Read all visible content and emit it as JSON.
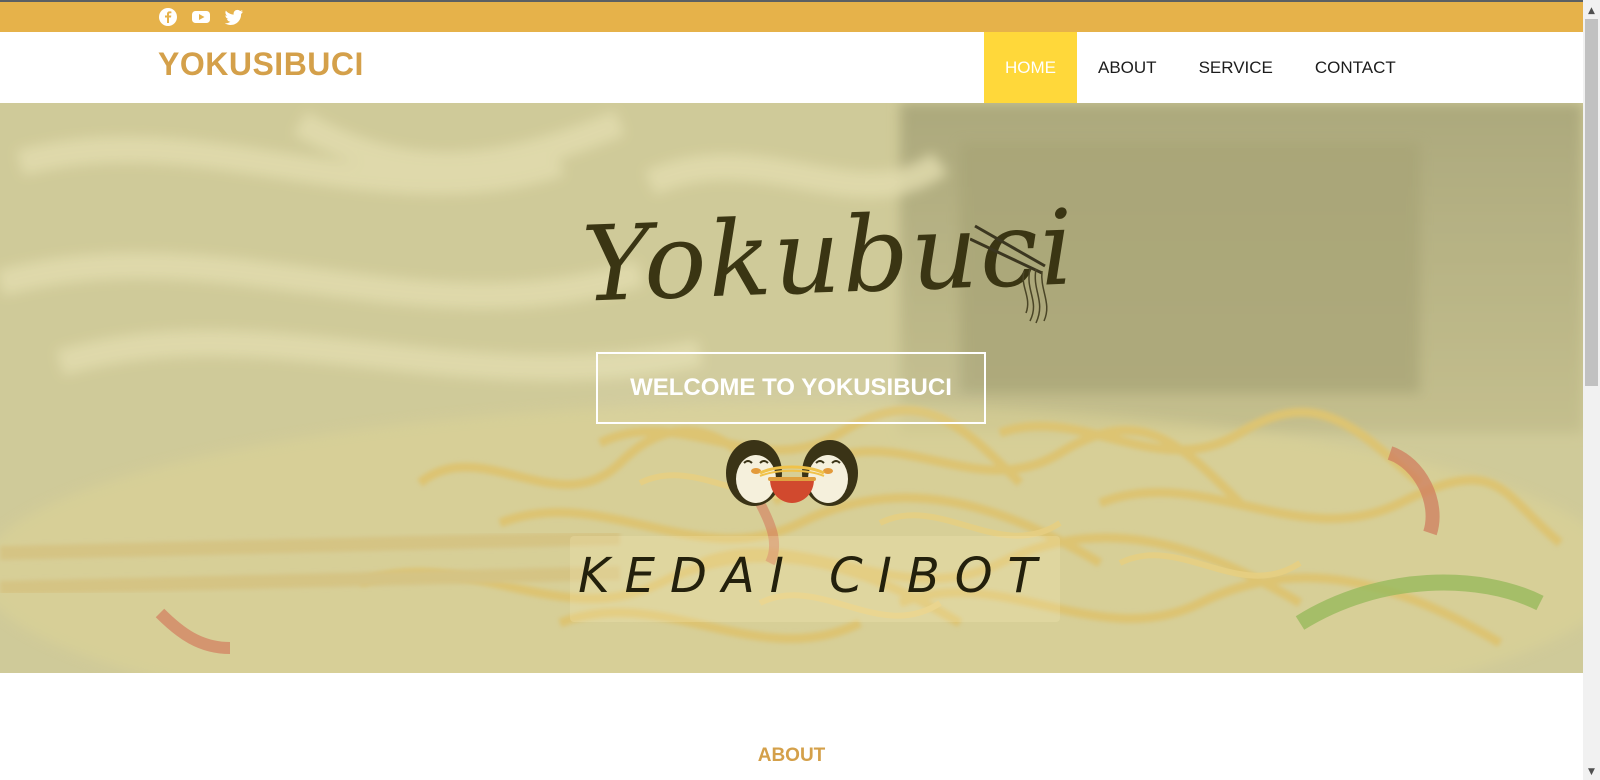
{
  "topbar": {
    "social": [
      {
        "icon": "facebook-icon"
      },
      {
        "icon": "youtube-icon"
      },
      {
        "icon": "twitter-icon"
      }
    ],
    "color": "#e6b24a"
  },
  "header": {
    "brand": "YOKUSIBUCI",
    "brand_color": "#d4a04a",
    "nav": [
      {
        "label": "HOME",
        "active": true
      },
      {
        "label": "ABOUT",
        "active": false
      },
      {
        "label": "SERVICE",
        "active": false
      },
      {
        "label": "CONTACT",
        "active": false
      }
    ],
    "active_color": "#ffd83a"
  },
  "hero": {
    "logo_text": "Yokubuci",
    "welcome_button": "WELCOME TO YOKUSIBUCI",
    "tagline": "KEDAI CIBOT"
  },
  "about": {
    "heading": "ABOUT"
  }
}
